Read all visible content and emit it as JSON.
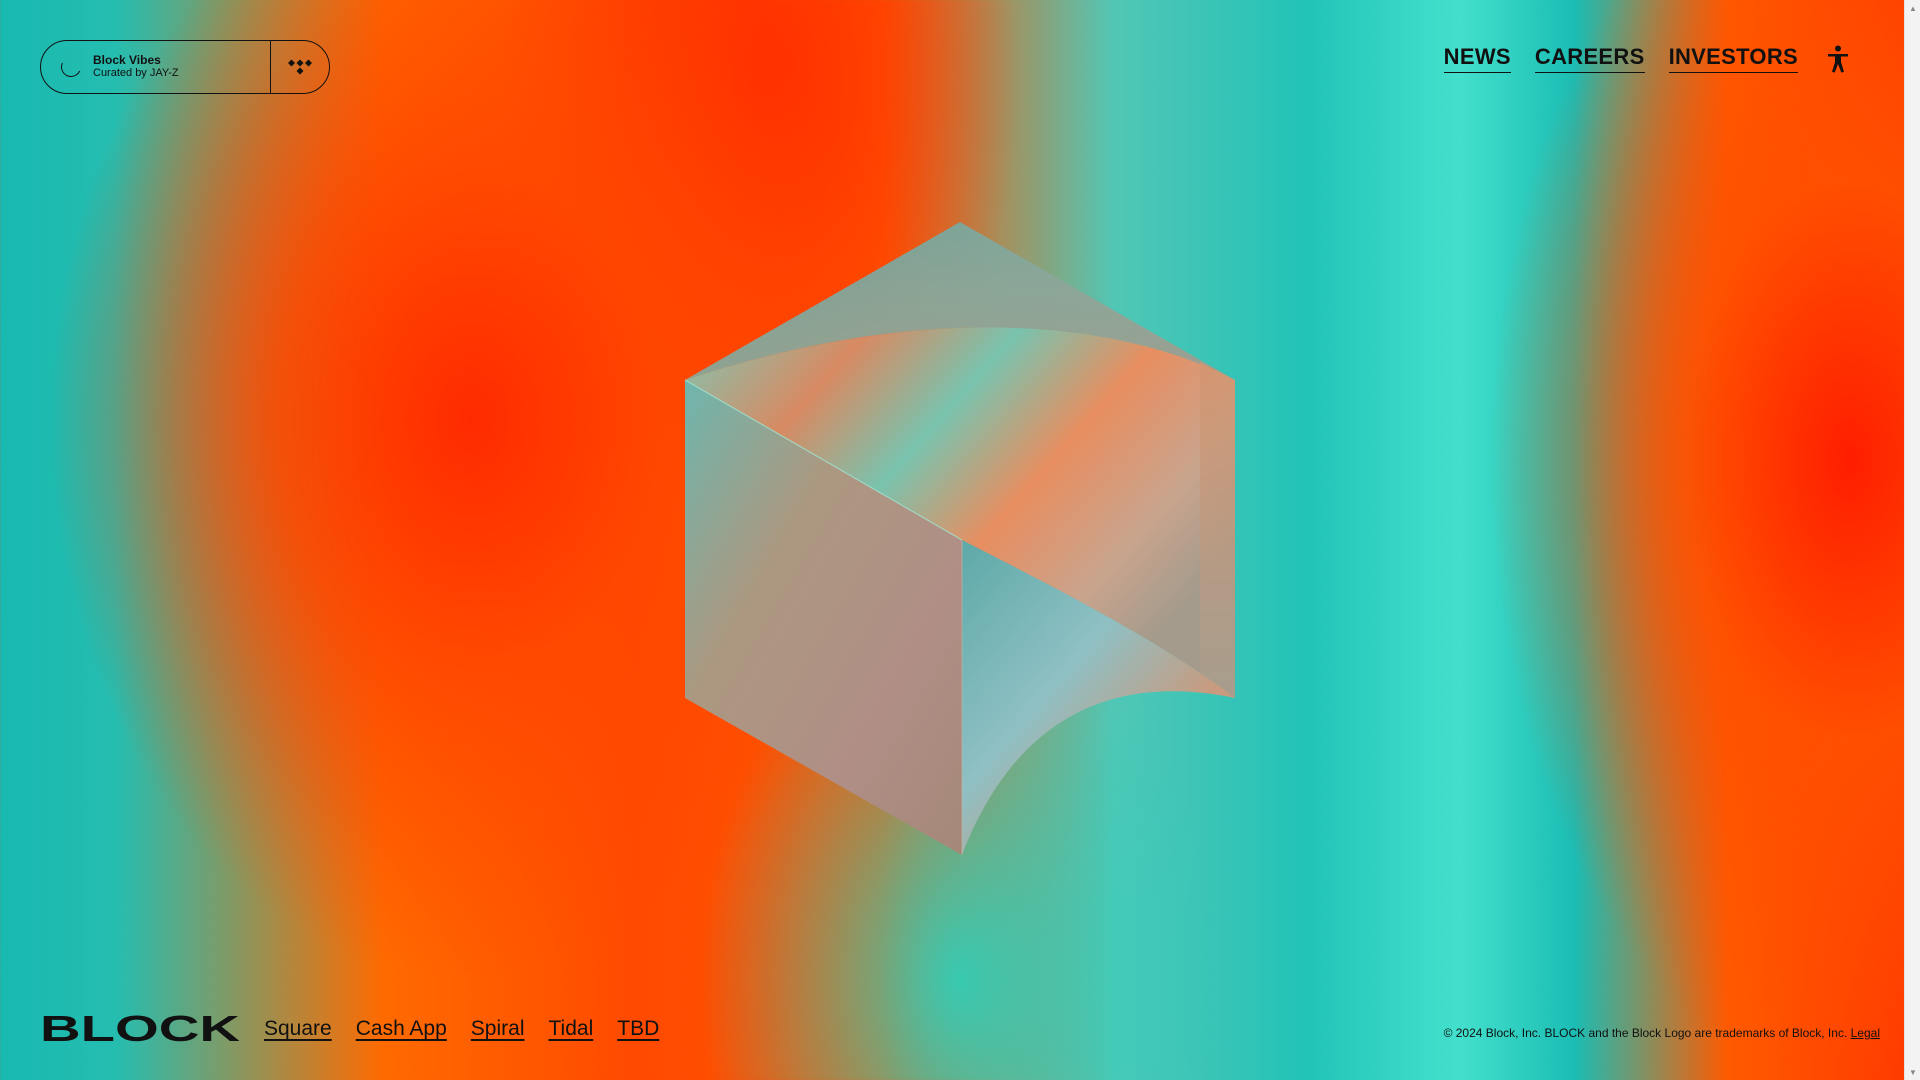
{
  "player": {
    "title": "Block Vibes",
    "subtitle": "Curated by JAY-Z",
    "service_icon": "tidal-icon",
    "status_icon": "loading-spinner-icon"
  },
  "nav": {
    "items": [
      {
        "label": "NEWS"
      },
      {
        "label": "CAREERS"
      },
      {
        "label": "INVESTORS"
      }
    ],
    "accessibility_icon": "accessibility-icon"
  },
  "hero": {
    "graphic": "iridescent-cube-graphic"
  },
  "footer": {
    "logo_text": "BLOCK",
    "links": [
      {
        "label": "Square"
      },
      {
        "label": "Cash App"
      },
      {
        "label": "Spiral"
      },
      {
        "label": "Tidal"
      },
      {
        "label": "TBD"
      }
    ],
    "copyright": "© 2024 Block, Inc. BLOCK and the Block Logo are trademarks of Block, Inc.",
    "legal_label": "Legal"
  },
  "colors": {
    "ink": "#111111",
    "orange": "#ff4a00",
    "teal": "#22c3b8"
  }
}
